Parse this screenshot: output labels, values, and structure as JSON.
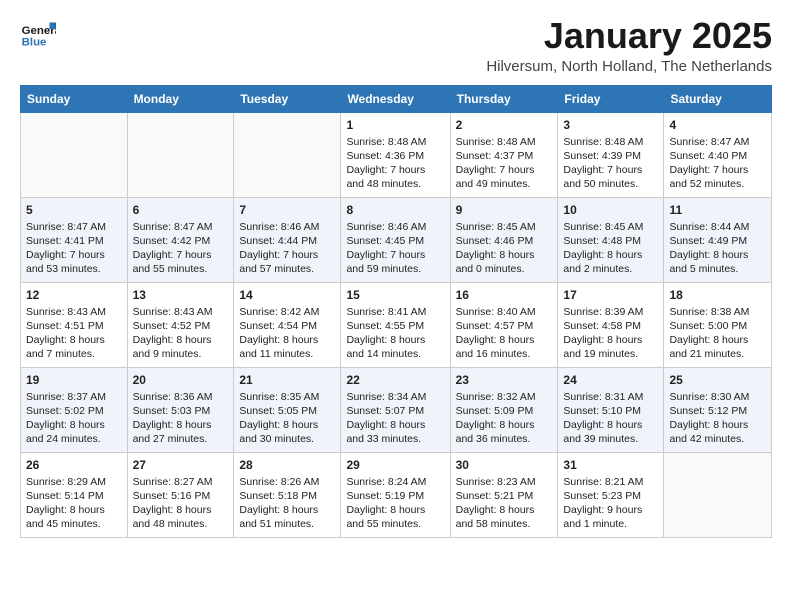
{
  "logo": {
    "line1": "General",
    "line2": "Blue"
  },
  "title": "January 2025",
  "location": "Hilversum, North Holland, The Netherlands",
  "weekdays": [
    "Sunday",
    "Monday",
    "Tuesday",
    "Wednesday",
    "Thursday",
    "Friday",
    "Saturday"
  ],
  "weeks": [
    [
      {
        "day": "",
        "info": ""
      },
      {
        "day": "",
        "info": ""
      },
      {
        "day": "",
        "info": ""
      },
      {
        "day": "1",
        "info": "Sunrise: 8:48 AM\nSunset: 4:36 PM\nDaylight: 7 hours\nand 48 minutes."
      },
      {
        "day": "2",
        "info": "Sunrise: 8:48 AM\nSunset: 4:37 PM\nDaylight: 7 hours\nand 49 minutes."
      },
      {
        "day": "3",
        "info": "Sunrise: 8:48 AM\nSunset: 4:39 PM\nDaylight: 7 hours\nand 50 minutes."
      },
      {
        "day": "4",
        "info": "Sunrise: 8:47 AM\nSunset: 4:40 PM\nDaylight: 7 hours\nand 52 minutes."
      }
    ],
    [
      {
        "day": "5",
        "info": "Sunrise: 8:47 AM\nSunset: 4:41 PM\nDaylight: 7 hours\nand 53 minutes."
      },
      {
        "day": "6",
        "info": "Sunrise: 8:47 AM\nSunset: 4:42 PM\nDaylight: 7 hours\nand 55 minutes."
      },
      {
        "day": "7",
        "info": "Sunrise: 8:46 AM\nSunset: 4:44 PM\nDaylight: 7 hours\nand 57 minutes."
      },
      {
        "day": "8",
        "info": "Sunrise: 8:46 AM\nSunset: 4:45 PM\nDaylight: 7 hours\nand 59 minutes."
      },
      {
        "day": "9",
        "info": "Sunrise: 8:45 AM\nSunset: 4:46 PM\nDaylight: 8 hours\nand 0 minutes."
      },
      {
        "day": "10",
        "info": "Sunrise: 8:45 AM\nSunset: 4:48 PM\nDaylight: 8 hours\nand 2 minutes."
      },
      {
        "day": "11",
        "info": "Sunrise: 8:44 AM\nSunset: 4:49 PM\nDaylight: 8 hours\nand 5 minutes."
      }
    ],
    [
      {
        "day": "12",
        "info": "Sunrise: 8:43 AM\nSunset: 4:51 PM\nDaylight: 8 hours\nand 7 minutes."
      },
      {
        "day": "13",
        "info": "Sunrise: 8:43 AM\nSunset: 4:52 PM\nDaylight: 8 hours\nand 9 minutes."
      },
      {
        "day": "14",
        "info": "Sunrise: 8:42 AM\nSunset: 4:54 PM\nDaylight: 8 hours\nand 11 minutes."
      },
      {
        "day": "15",
        "info": "Sunrise: 8:41 AM\nSunset: 4:55 PM\nDaylight: 8 hours\nand 14 minutes."
      },
      {
        "day": "16",
        "info": "Sunrise: 8:40 AM\nSunset: 4:57 PM\nDaylight: 8 hours\nand 16 minutes."
      },
      {
        "day": "17",
        "info": "Sunrise: 8:39 AM\nSunset: 4:58 PM\nDaylight: 8 hours\nand 19 minutes."
      },
      {
        "day": "18",
        "info": "Sunrise: 8:38 AM\nSunset: 5:00 PM\nDaylight: 8 hours\nand 21 minutes."
      }
    ],
    [
      {
        "day": "19",
        "info": "Sunrise: 8:37 AM\nSunset: 5:02 PM\nDaylight: 8 hours\nand 24 minutes."
      },
      {
        "day": "20",
        "info": "Sunrise: 8:36 AM\nSunset: 5:03 PM\nDaylight: 8 hours\nand 27 minutes."
      },
      {
        "day": "21",
        "info": "Sunrise: 8:35 AM\nSunset: 5:05 PM\nDaylight: 8 hours\nand 30 minutes."
      },
      {
        "day": "22",
        "info": "Sunrise: 8:34 AM\nSunset: 5:07 PM\nDaylight: 8 hours\nand 33 minutes."
      },
      {
        "day": "23",
        "info": "Sunrise: 8:32 AM\nSunset: 5:09 PM\nDaylight: 8 hours\nand 36 minutes."
      },
      {
        "day": "24",
        "info": "Sunrise: 8:31 AM\nSunset: 5:10 PM\nDaylight: 8 hours\nand 39 minutes."
      },
      {
        "day": "25",
        "info": "Sunrise: 8:30 AM\nSunset: 5:12 PM\nDaylight: 8 hours\nand 42 minutes."
      }
    ],
    [
      {
        "day": "26",
        "info": "Sunrise: 8:29 AM\nSunset: 5:14 PM\nDaylight: 8 hours\nand 45 minutes."
      },
      {
        "day": "27",
        "info": "Sunrise: 8:27 AM\nSunset: 5:16 PM\nDaylight: 8 hours\nand 48 minutes."
      },
      {
        "day": "28",
        "info": "Sunrise: 8:26 AM\nSunset: 5:18 PM\nDaylight: 8 hours\nand 51 minutes."
      },
      {
        "day": "29",
        "info": "Sunrise: 8:24 AM\nSunset: 5:19 PM\nDaylight: 8 hours\nand 55 minutes."
      },
      {
        "day": "30",
        "info": "Sunrise: 8:23 AM\nSunset: 5:21 PM\nDaylight: 8 hours\nand 58 minutes."
      },
      {
        "day": "31",
        "info": "Sunrise: 8:21 AM\nSunset: 5:23 PM\nDaylight: 9 hours\nand 1 minute."
      },
      {
        "day": "",
        "info": ""
      }
    ]
  ]
}
